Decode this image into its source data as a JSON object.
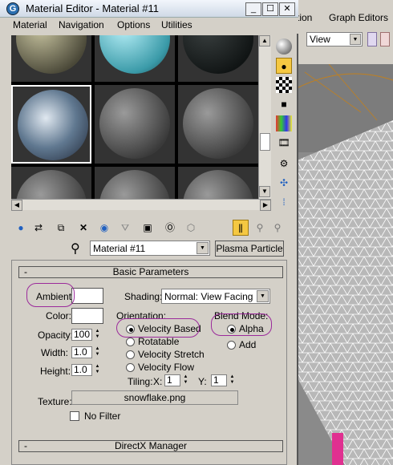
{
  "window": {
    "title": "Material Editor - Material #11",
    "minimize": "_",
    "maximize": "☐",
    "close": "✕"
  },
  "menu": [
    "Material",
    "Navigation",
    "Options",
    "Utilities"
  ],
  "background_app": {
    "menu_partial": "tion",
    "menu_graph_editors": "Graph Editors",
    "viewport_label": "View"
  },
  "toolbar": {
    "material_name": "Material #11",
    "material_type": "Plasma Particle"
  },
  "basic_parameters": {
    "title": "Basic Parameters",
    "ambient_label": "Ambient:",
    "color_label": "Color:",
    "opacity_label": "Opacity:",
    "opacity_value": "100",
    "width_label": "Width:",
    "width_value": "1.0",
    "height_label": "Height:",
    "height_value": "1.0",
    "shading_label": "Shading:",
    "shading_value": "Normal: View Facing",
    "orientation_label": "Orientation:",
    "orientation_options": [
      "Velocity Based",
      "Rotatable",
      "Velocity Stretch",
      "Velocity Flow"
    ],
    "orientation_selected": "Velocity Based",
    "blend_mode_label": "Blend Mode:",
    "blend_options": [
      "Alpha",
      "Add"
    ],
    "blend_selected": "Alpha",
    "tiling_label": "Tiling:",
    "tiling_x_label": "X:",
    "tiling_x_value": "1",
    "tiling_y_label": "Y:",
    "tiling_y_value": "1",
    "texture_label": "Texture:",
    "texture_value": "snowflake.png",
    "no_filter_label": "No Filter"
  },
  "directx": {
    "title": "DirectX Manager"
  },
  "colors": {
    "accent_highlight": "#f5c842",
    "annotation": "#9b2a9b",
    "swatch": "#ffffff"
  }
}
